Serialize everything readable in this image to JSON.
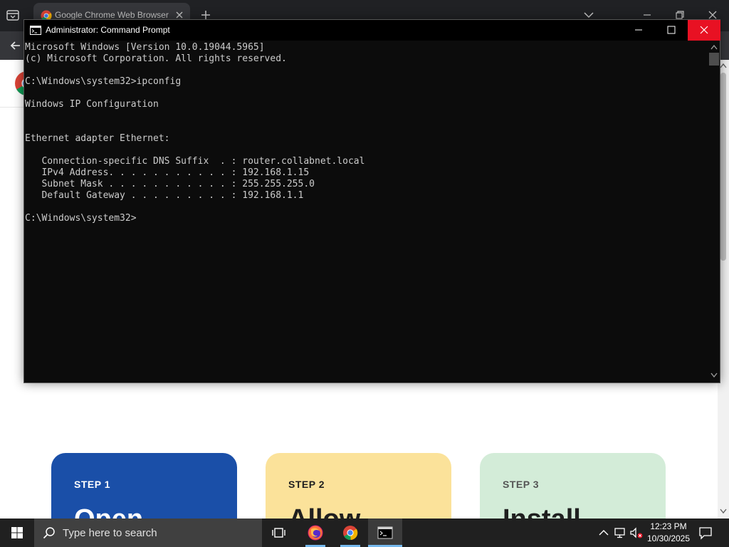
{
  "chrome": {
    "tab_title": "Google Chrome Web Browser: D",
    "page": {
      "cards": [
        {
          "step": "STEP 1",
          "heading": "Open"
        },
        {
          "step": "STEP 2",
          "heading": "Allow"
        },
        {
          "step": "STEP 3",
          "heading": "Install"
        }
      ]
    }
  },
  "cmd": {
    "title": "Administrator: Command Prompt",
    "lines": [
      "Microsoft Windows [Version 10.0.19044.5965]",
      "(c) Microsoft Corporation. All rights reserved.",
      "",
      "C:\\Windows\\system32>ipconfig",
      "",
      "Windows IP Configuration",
      "",
      "",
      "Ethernet adapter Ethernet:",
      "",
      "   Connection-specific DNS Suffix  . : router.collabnet.local",
      "   IPv4 Address. . . . . . . . . . . : 192.168.1.15",
      "   Subnet Mask . . . . . . . . . . . : 255.255.255.0",
      "   Default Gateway . . . . . . . . . : 192.168.1.1",
      "",
      "C:\\Windows\\system32>"
    ]
  },
  "taskbar": {
    "search_placeholder": "Type here to search",
    "time": "12:23 PM",
    "date": "10/30/2025"
  },
  "colors": {
    "close_red": "#e81123",
    "card1": "#1a4fa8",
    "card2": "#fbe29a",
    "card3": "#d3ecd8",
    "taskbar": "#202020",
    "cmd_background": "#0c0c0c",
    "cmd_text": "#cccccc"
  },
  "icons": {
    "chrome_tab": [
      "tab-search-icon",
      "chrome-favicon-icon",
      "tab-close-icon",
      "new-tab-icon"
    ],
    "window_controls": [
      "minimize-icon",
      "maximize-icon",
      "close-icon"
    ],
    "taskbar_apps": [
      "windows-start-icon",
      "search-icon",
      "task-view-icon",
      "firefox-icon",
      "chrome-icon",
      "command-prompt-icon"
    ],
    "tray": [
      "chevron-up-icon",
      "network-icon",
      "volume-muted-icon",
      "notification-icon"
    ]
  }
}
